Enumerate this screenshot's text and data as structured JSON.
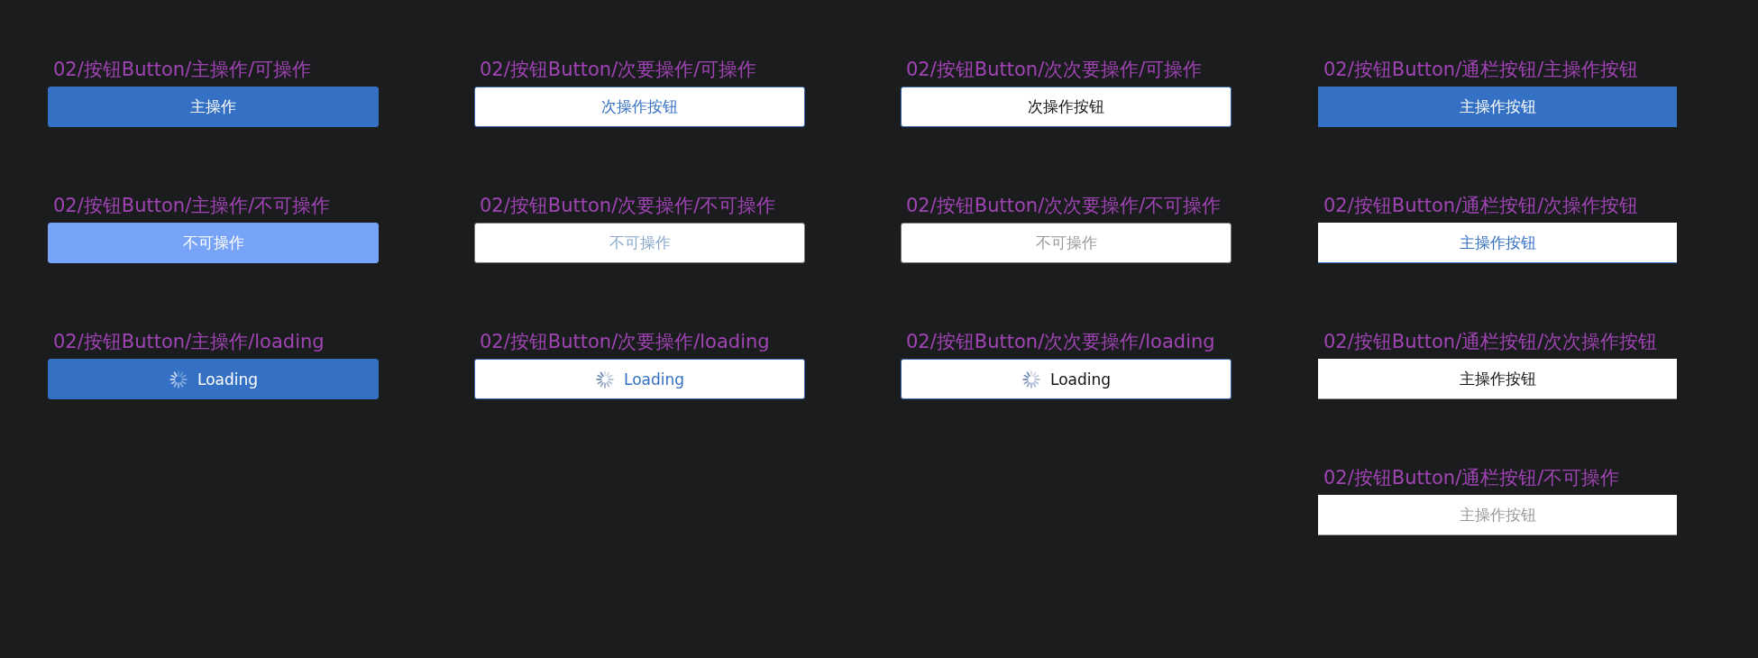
{
  "columns": [
    {
      "items": [
        {
          "title": "02/按钮Button/主操作/可操作",
          "button": {
            "label": "主操作",
            "kind": "primary",
            "disabled": false,
            "loading": false
          }
        },
        {
          "title": "02/按钮Button/主操作/不可操作",
          "button": {
            "label": "不可操作",
            "kind": "primary",
            "disabled": true,
            "loading": false
          }
        },
        {
          "title": "02/按钮Button/主操作/loading",
          "button": {
            "label": "Loading",
            "kind": "primary",
            "disabled": false,
            "loading": true
          }
        }
      ]
    },
    {
      "items": [
        {
          "title": "02/按钮Button/次要操作/可操作",
          "button": {
            "label": "次操作按钮",
            "kind": "secondary",
            "disabled": false,
            "loading": false
          }
        },
        {
          "title": "02/按钮Button/次要操作/不可操作",
          "button": {
            "label": "不可操作",
            "kind": "secondary",
            "disabled": true,
            "loading": false
          }
        },
        {
          "title": "02/按钮Button/次要操作/loading",
          "button": {
            "label": "Loading",
            "kind": "secondary",
            "disabled": false,
            "loading": true
          }
        }
      ]
    },
    {
      "items": [
        {
          "title": "02/按钮Button/次次要操作/可操作",
          "button": {
            "label": "次操作按钮",
            "kind": "tertiary",
            "disabled": false,
            "loading": false
          }
        },
        {
          "title": "02/按钮Button/次次要操作/不可操作",
          "button": {
            "label": "不可操作",
            "kind": "tertiary",
            "disabled": true,
            "loading": false
          }
        },
        {
          "title": "02/按钮Button/次次要操作/loading",
          "button": {
            "label": "Loading",
            "kind": "tertiary",
            "disabled": false,
            "loading": true
          }
        }
      ]
    },
    {
      "items": [
        {
          "title": "02/按钮Button/通栏按钮/主操作按钮",
          "button": {
            "label": "主操作按钮",
            "kind": "banner-primary",
            "disabled": false,
            "loading": false
          }
        },
        {
          "title": "02/按钮Button/通栏按钮/次操作按钮",
          "button": {
            "label": "主操作按钮",
            "kind": "banner-secondary",
            "disabled": false,
            "loading": false
          }
        },
        {
          "title": "02/按钮Button/通栏按钮/次次操作按钮",
          "button": {
            "label": "主操作按钮",
            "kind": "banner-tertiary",
            "disabled": false,
            "loading": false
          }
        },
        {
          "title": "02/按钮Button/通栏按钮/不可操作",
          "button": {
            "label": "主操作按钮",
            "kind": "banner-tertiary",
            "disabled": true,
            "loading": false
          }
        }
      ]
    }
  ]
}
